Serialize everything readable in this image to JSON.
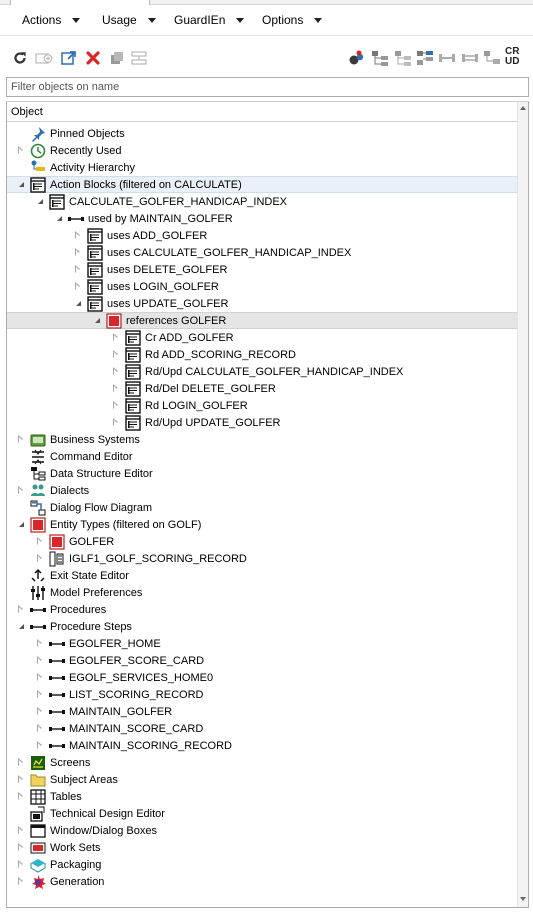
{
  "menubar": {
    "items": [
      {
        "label": "Actions"
      },
      {
        "label": "Usage"
      },
      {
        "label": "GuardIEn"
      },
      {
        "label": "Options"
      }
    ]
  },
  "toolbar": {
    "left": [
      "refresh-icon",
      "add-object-icon",
      "open-external-icon",
      "delete-icon",
      "copy-icon",
      "collapse-all-icon"
    ],
    "right": [
      "find-usage-icon",
      "tree-view-icon",
      "tree-view-2-icon",
      "tree-view-3-icon",
      "link-view-icon",
      "link-view-2-icon",
      "link-view-3-icon"
    ],
    "crud_label_top": "CR",
    "crud_label_bottom": "UD"
  },
  "filter": {
    "placeholder": "Filter objects on name",
    "value": ""
  },
  "tree": {
    "column_header": "Object",
    "rows": [
      {
        "level": 0,
        "state": "none",
        "icon": "pin-icon",
        "label": "Pinned Objects"
      },
      {
        "level": 0,
        "state": "collapsed",
        "icon": "clock-icon",
        "label": "Recently Used"
      },
      {
        "level": 0,
        "state": "none",
        "icon": "hierarchy-icon",
        "label": "Activity Hierarchy"
      },
      {
        "level": 0,
        "state": "expanded",
        "icon": "action-block-icon",
        "label": "Action Blocks (filtered on CALCULATE)",
        "style": "hl"
      },
      {
        "level": 1,
        "state": "expanded",
        "icon": "action-block-icon",
        "label": "CALCULATE_GOLFER_HANDICAP_INDEX"
      },
      {
        "level": 2,
        "state": "expanded",
        "icon": "connector-icon",
        "label": "used by MAINTAIN_GOLFER"
      },
      {
        "level": 3,
        "state": "collapsed",
        "icon": "action-block-icon",
        "label": "uses ADD_GOLFER"
      },
      {
        "level": 3,
        "state": "collapsed",
        "icon": "action-block-icon",
        "label": "uses CALCULATE_GOLFER_HANDICAP_INDEX"
      },
      {
        "level": 3,
        "state": "collapsed",
        "icon": "action-block-icon",
        "label": "uses DELETE_GOLFER"
      },
      {
        "level": 3,
        "state": "collapsed",
        "icon": "action-block-icon",
        "label": "uses LOGIN_GOLFER"
      },
      {
        "level": 3,
        "state": "expanded",
        "icon": "action-block-icon",
        "label": "uses UPDATE_GOLFER"
      },
      {
        "level": 4,
        "state": "expanded",
        "icon": "entity-type-icon",
        "label": "references GOLFER",
        "style": "sel"
      },
      {
        "level": 5,
        "state": "collapsed",
        "icon": "action-block-icon",
        "label": "Cr ADD_GOLFER"
      },
      {
        "level": 5,
        "state": "collapsed",
        "icon": "action-block-icon",
        "label": "Rd ADD_SCORING_RECORD"
      },
      {
        "level": 5,
        "state": "collapsed",
        "icon": "action-block-icon",
        "label": "Rd/Upd CALCULATE_GOLFER_HANDICAP_INDEX"
      },
      {
        "level": 5,
        "state": "collapsed",
        "icon": "action-block-icon",
        "label": "Rd/Del DELETE_GOLFER"
      },
      {
        "level": 5,
        "state": "collapsed",
        "icon": "action-block-icon",
        "label": "Rd LOGIN_GOLFER"
      },
      {
        "level": 5,
        "state": "collapsed",
        "icon": "action-block-icon",
        "label": "Rd/Upd UPDATE_GOLFER"
      },
      {
        "level": 0,
        "state": "collapsed",
        "icon": "business-systems-icon",
        "label": "Business Systems"
      },
      {
        "level": 0,
        "state": "none",
        "icon": "command-editor-icon",
        "label": "Command Editor"
      },
      {
        "level": 0,
        "state": "none",
        "icon": "data-structure-icon",
        "label": "Data Structure Editor"
      },
      {
        "level": 0,
        "state": "collapsed",
        "icon": "dialects-icon",
        "label": "Dialects"
      },
      {
        "level": 0,
        "state": "none",
        "icon": "dialog-flow-icon",
        "label": "Dialog Flow Diagram"
      },
      {
        "level": 0,
        "state": "expanded",
        "icon": "entity-type-icon",
        "label": "Entity Types (filtered on GOLF)"
      },
      {
        "level": 1,
        "state": "collapsed",
        "icon": "entity-type-icon",
        "label": "GOLFER"
      },
      {
        "level": 1,
        "state": "collapsed",
        "icon": "index-icon",
        "label": "IGLF1_GOLF_SCORING_RECORD"
      },
      {
        "level": 0,
        "state": "none",
        "icon": "exit-state-icon",
        "label": "Exit State Editor"
      },
      {
        "level": 0,
        "state": "none",
        "icon": "preferences-icon",
        "label": "Model Preferences"
      },
      {
        "level": 0,
        "state": "collapsed",
        "icon": "procedure-icon",
        "label": "Procedures"
      },
      {
        "level": 0,
        "state": "expanded",
        "icon": "procedure-step-icon",
        "label": "Procedure Steps"
      },
      {
        "level": 1,
        "state": "collapsed",
        "icon": "procedure-step-icon",
        "label": "EGOLFER_HOME"
      },
      {
        "level": 1,
        "state": "collapsed",
        "icon": "procedure-step-icon",
        "label": "EGOLFER_SCORE_CARD"
      },
      {
        "level": 1,
        "state": "collapsed",
        "icon": "procedure-step-icon",
        "label": "EGOLF_SERVICES_HOME0"
      },
      {
        "level": 1,
        "state": "collapsed",
        "icon": "procedure-step-icon",
        "label": "LIST_SCORING_RECORD"
      },
      {
        "level": 1,
        "state": "collapsed",
        "icon": "procedure-step-icon",
        "label": "MAINTAIN_GOLFER"
      },
      {
        "level": 1,
        "state": "collapsed",
        "icon": "procedure-step-icon",
        "label": "MAINTAIN_SCORE_CARD"
      },
      {
        "level": 1,
        "state": "collapsed",
        "icon": "procedure-step-icon",
        "label": "MAINTAIN_SCORING_RECORD"
      },
      {
        "level": 0,
        "state": "collapsed",
        "icon": "screens-icon",
        "label": "Screens"
      },
      {
        "level": 0,
        "state": "collapsed",
        "icon": "folder-icon",
        "label": "Subject Areas"
      },
      {
        "level": 0,
        "state": "collapsed",
        "icon": "table-icon",
        "label": "Tables"
      },
      {
        "level": 0,
        "state": "none",
        "icon": "technical-design-icon",
        "label": "Technical Design Editor"
      },
      {
        "level": 0,
        "state": "collapsed",
        "icon": "window-icon",
        "label": "Window/Dialog Boxes"
      },
      {
        "level": 0,
        "state": "collapsed",
        "icon": "work-sets-icon",
        "label": "Work Sets"
      },
      {
        "level": 0,
        "state": "collapsed",
        "icon": "packaging-icon",
        "label": "Packaging"
      },
      {
        "level": 0,
        "state": "collapsed",
        "icon": "generation-icon",
        "label": "Generation"
      }
    ]
  }
}
